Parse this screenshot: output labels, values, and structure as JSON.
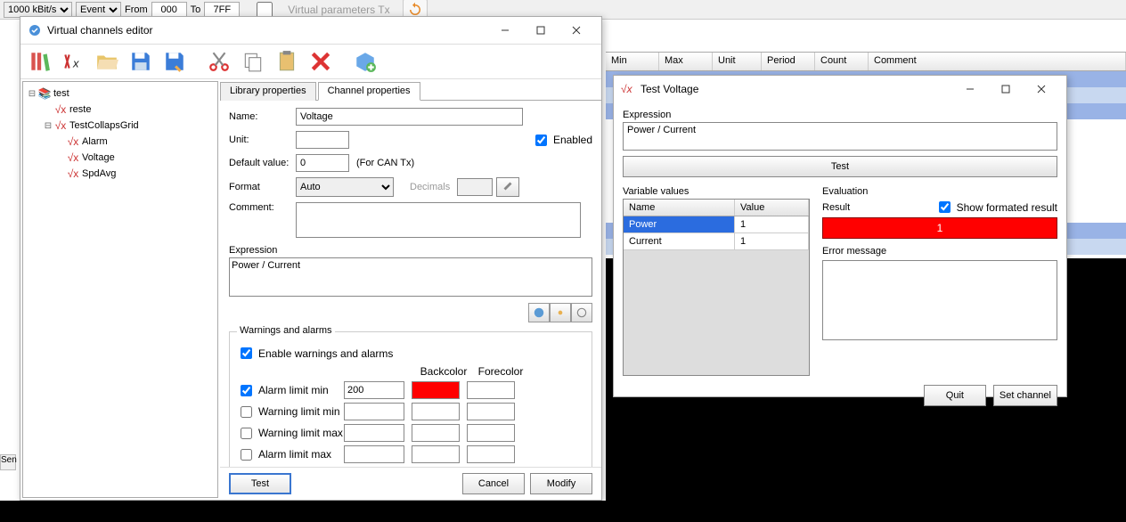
{
  "top": {
    "baud": "1000 kBit/s",
    "mode": "Event",
    "from_label": "From",
    "from_val": "000",
    "to_label": "To",
    "to_val": "7FF",
    "virtual_param": "Virtual parameters Tx"
  },
  "bg_headers": {
    "min": "Min",
    "max": "Max",
    "unit": "Unit",
    "period": "Period",
    "count": "Count",
    "comment": "Comment"
  },
  "side_btn": "Sen",
  "editor": {
    "title": "Virtual channels editor",
    "tree": {
      "root": "test",
      "n1": "reste",
      "n2": "TestCollapsGrid",
      "c1": "Alarm",
      "c2": "Voltage",
      "c3": "SpdAvg"
    },
    "tabs": {
      "lib": "Library properties",
      "chan": "Channel properties"
    },
    "labels": {
      "name": "Name:",
      "unit": "Unit:",
      "default": "Default value:",
      "default_hint": "(For CAN Tx)",
      "format": "Format",
      "decimals": "Decimals",
      "comment": "Comment:",
      "enabled": "Enabled",
      "expression": "Expression",
      "warnings_group": "Warnings and alarms",
      "enable_warn": "Enable warnings and alarms",
      "alarm_min": "Alarm limit min",
      "warn_min": "Warning limit min",
      "warn_max": "Warning limit max",
      "alarm_max": "Alarm limit max",
      "backcolor": "Backcolor",
      "forecolor": "Forecolor"
    },
    "vals": {
      "name": "Voltage",
      "unit": "",
      "default": "0",
      "format": "Auto",
      "enabled": true,
      "comment": "",
      "expression": "Power / Current",
      "enable_warn": true,
      "alarm_min_en": true,
      "alarm_min_val": "200",
      "alarm_min_back": "#ff0000",
      "alarm_min_fore": "#ffffff"
    },
    "buttons": {
      "test": "Test",
      "cancel": "Cancel",
      "modify": "Modify"
    }
  },
  "testdlg": {
    "title": "Test Voltage",
    "labels": {
      "expression": "Expression",
      "test": "Test",
      "varvals": "Variable values",
      "name": "Name",
      "value": "Value",
      "evaluation": "Evaluation",
      "result": "Result",
      "show_formatted": "Show formated result",
      "error": "Error message",
      "quit": "Quit",
      "set_channel": "Set channel"
    },
    "expression": "Power / Current",
    "vars": [
      {
        "name": "Power",
        "value": "1"
      },
      {
        "name": "Current",
        "value": "1"
      }
    ],
    "result": "1",
    "show_formatted": true
  }
}
